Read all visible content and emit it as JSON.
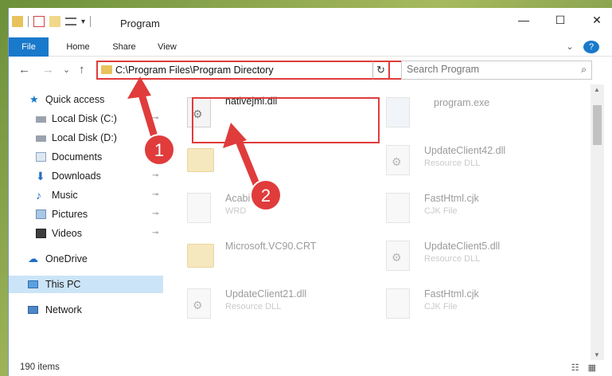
{
  "window": {
    "title": "Program",
    "controls": {
      "minimize": "—",
      "maximize": "☐",
      "close": "✕"
    }
  },
  "ribbon": {
    "tabs": [
      "File",
      "Home",
      "Share",
      "View"
    ],
    "help": "?",
    "expand": "⌄"
  },
  "nav": {
    "back": "←",
    "forward": "→",
    "recent": "⌄",
    "up": "↑",
    "address": "C:\\Program Files\\Program Directory",
    "address_dropdown": "⌄",
    "refresh": "↻",
    "search_placeholder": "Search Program"
  },
  "sidebar": {
    "items": [
      {
        "label": "Quick access",
        "icon": "star-icon",
        "pinned": false
      },
      {
        "label": "Local Disk (C:)",
        "icon": "drive-icon",
        "pinned": true
      },
      {
        "label": "Local Disk (D:)",
        "icon": "drive-icon",
        "pinned": false
      },
      {
        "label": "Documents",
        "icon": "documents-icon",
        "pinned": true
      },
      {
        "label": "Downloads",
        "icon": "downloads-icon",
        "pinned": true
      },
      {
        "label": "Music",
        "icon": "music-icon",
        "pinned": true
      },
      {
        "label": "Pictures",
        "icon": "pictures-icon",
        "pinned": true
      },
      {
        "label": "Videos",
        "icon": "videos-icon",
        "pinned": true
      },
      {
        "label": "OneDrive",
        "icon": "cloud-icon",
        "pinned": false
      },
      {
        "label": "This PC",
        "icon": "computer-icon",
        "pinned": false,
        "selected": true
      },
      {
        "label": "Network",
        "icon": "network-icon",
        "pinned": false
      }
    ],
    "pin_glyph": "📌"
  },
  "files": [
    {
      "name": "nativejmi.dll",
      "type": "",
      "kind": "dll",
      "highlighted": true
    },
    {
      "name": "program.exe",
      "type": "",
      "kind": "exe"
    },
    {
      "name": "",
      "type": "",
      "kind": "folder"
    },
    {
      "name": "UpdateClient42.dll",
      "type": "Resource DLL",
      "kind": "dll"
    },
    {
      "name": "Acabi",
      "type": "WRD",
      "kind": "doc"
    },
    {
      "name": "FastHtml.cjk",
      "type": "CJK File",
      "kind": "doc"
    },
    {
      "name": "Microsoft.VC90.CRT",
      "type": "",
      "kind": "folder"
    },
    {
      "name": "UpdateClient5.dll",
      "type": "Resource DLL",
      "kind": "dll"
    },
    {
      "name": "UpdateClient21.dll",
      "type": "Resource DLL",
      "kind": "dll"
    },
    {
      "name": "FastHtml.cjk",
      "type": "CJK File",
      "kind": "doc"
    }
  ],
  "annotations": {
    "badge1": "1",
    "badge2": "2"
  },
  "status": {
    "count": "190 items",
    "views": "☷ ▦"
  },
  "colors": {
    "accent": "#1979ca",
    "highlight": "#e03c3c",
    "selected": "#cce4f7"
  }
}
